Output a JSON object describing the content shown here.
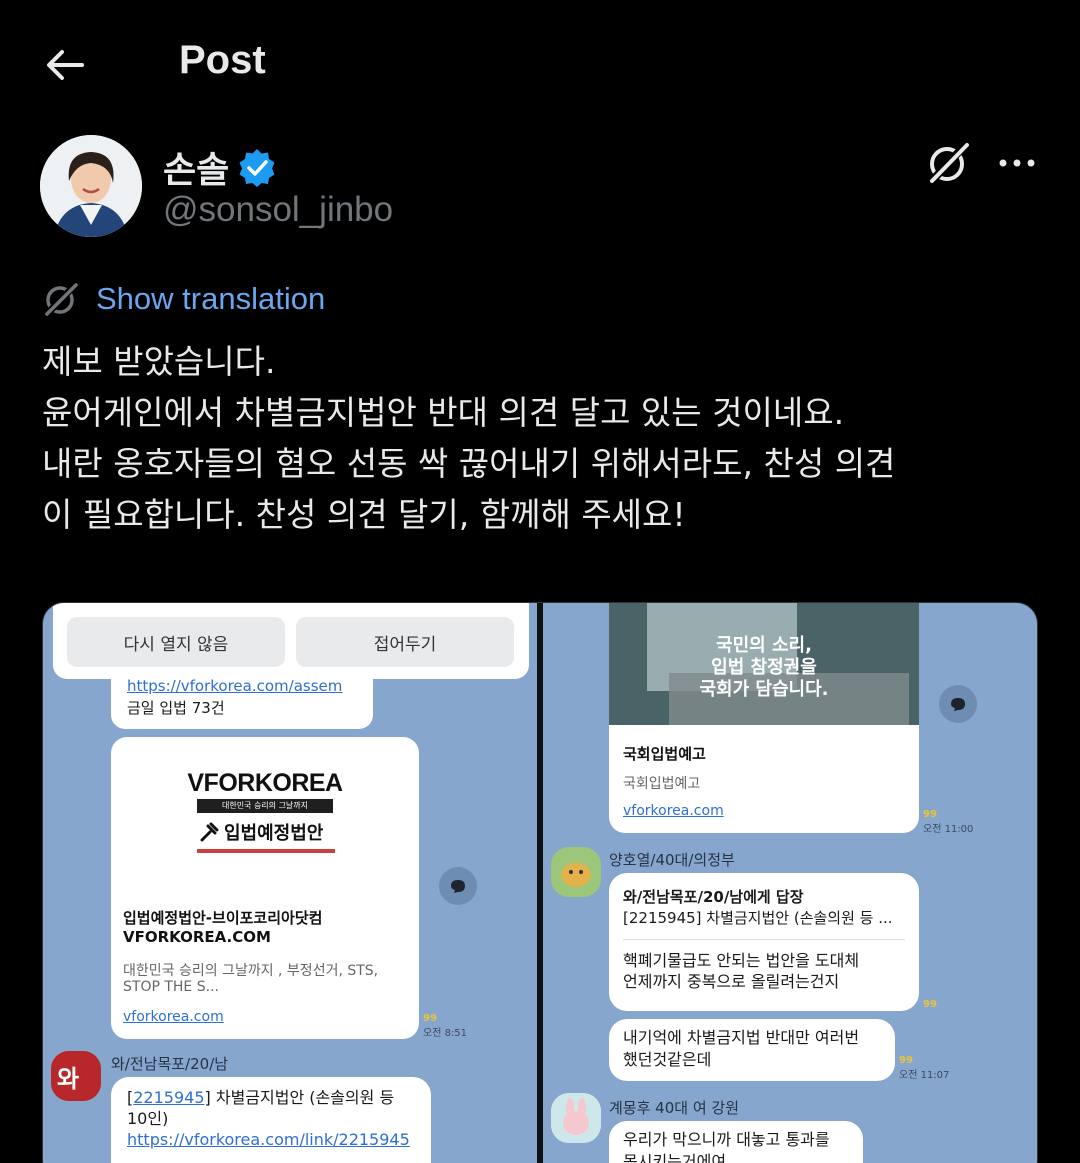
{
  "header": {
    "title": "Post"
  },
  "author": {
    "name": "손솔",
    "handle": "@sonsol_jinbo"
  },
  "translation": {
    "label": "Show translation"
  },
  "post": {
    "lines": [
      "제보 받았습니다.",
      "윤어게인에서 차별금지법안 반대 의견 달고 있는 것이네요.",
      "내란 옹호자들의 혐오 선동 싹 끊어내기 위해서라도, 찬성 의견",
      "이 필요합니다. 찬성 의견 달기, 함께해 주세요!"
    ]
  },
  "left_panel": {
    "buttons": {
      "no_reopen": "다시 열지 않음",
      "collapse": "접어두기"
    },
    "msg1": {
      "link": "https://vforkorea.com/assem",
      "text": "금일 입법 73건"
    },
    "card": {
      "logo": "VFORKOREA",
      "tagline": "대한민국 승리의 그날까지",
      "banner": "입법예정법안",
      "title": "입법예정법안-브이포코리아닷컴",
      "domain_caps": "VFORKOREA.COM",
      "desc_line1": "대한민국 승리의 그날까지 , 부정선거, STS,",
      "desc_line2": "STOP THE S...",
      "link": "vforkorea.com",
      "count": "99",
      "time": "오전 8:51"
    },
    "msg2": {
      "sender": "와/전남목포/20/남",
      "code": "2215945",
      "text_a": "] 차별금지법안 (손솔의원 등",
      "text_b": "10인)",
      "link": "https://vforkorea.com/link/2215945"
    }
  },
  "right_panel": {
    "card": {
      "image_caption_1": "국민의 소리,",
      "image_caption_2": "입법 참정권을",
      "image_caption_3": "국회가 담습니다.",
      "title": "국회입법예고",
      "subtitle": "국회입법예고",
      "link": "vforkorea.com",
      "count": "99",
      "time": "오전 11:00"
    },
    "msg1": {
      "sender": "양호열/40대/의정부",
      "reply_to": "와/전남목포/20/남에게 답장",
      "quote": "[2215945] 차별금지법안 (손솔의원 등 ...",
      "line1": "핵폐기물급도 안되는 법안을 도대체",
      "line2": "언제까지 중복으로 올릴려는건지",
      "count": "99"
    },
    "msg2": {
      "line1": "내기억에 차별금지법 반대만 여러번",
      "line2": "했던것같은데",
      "count": "99",
      "time": "오전 11:07"
    },
    "msg3": {
      "sender": "계몽후 40대 여 강원",
      "line1": "우리가 막으니까 대놓고 통과를",
      "line2": "못시키는거에여"
    }
  },
  "colors": {
    "accent": "#1d9bf0",
    "chat_bg": "#86a6cd",
    "verified": "#1d9bf0"
  },
  "icons": [
    "back-arrow-icon",
    "verified-badge-icon",
    "grok-icon",
    "more-icon",
    "translate-icon",
    "share-icon"
  ]
}
